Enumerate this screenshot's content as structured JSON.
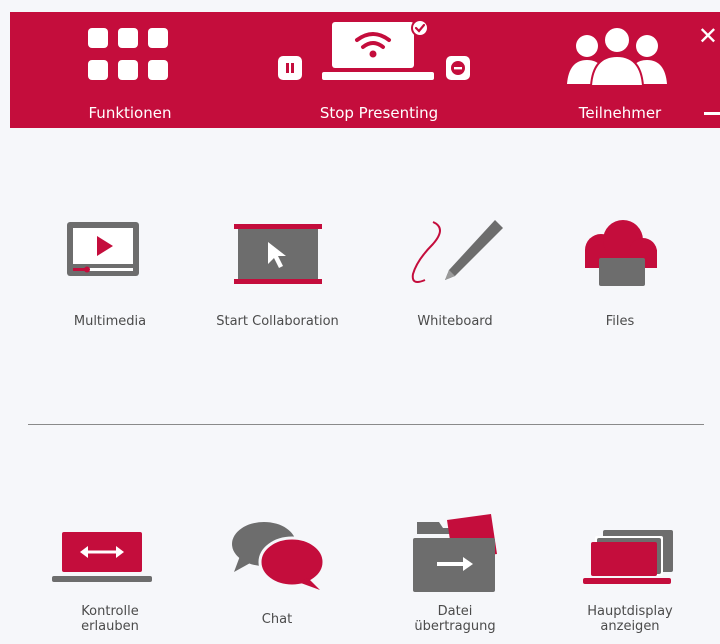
{
  "header": {
    "functions_label": "Funktionen",
    "stop_presenting_label": "Stop Presenting",
    "participants_label": "Teilnehmer"
  },
  "features": [
    {
      "label": "Multimedia"
    },
    {
      "label": "Start Collaboration"
    },
    {
      "label": "Whiteboard"
    },
    {
      "label": "Files"
    }
  ],
  "actions": [
    {
      "label_line1": "Kontrolle",
      "label_line2": "erlauben"
    },
    {
      "label_line1": "Chat"
    },
    {
      "label_line1": "Datei",
      "label_line2": "übertragung"
    },
    {
      "label_line1": "Hauptdisplay",
      "label_line2": "anzeigen"
    }
  ],
  "colors": {
    "accent": "#c40d3c",
    "icon_gray": "#6d6d6d",
    "background": "#f6f7fa"
  }
}
